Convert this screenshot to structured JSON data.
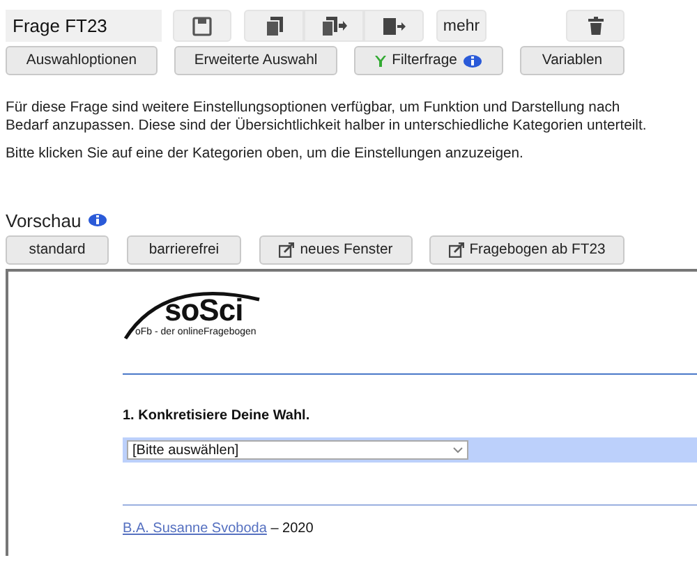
{
  "toolbar": {
    "question_field": {
      "value": "Frage FT23"
    },
    "save_button": {
      "kind": "save"
    },
    "copy_tools": [
      {
        "kind": "copy"
      },
      {
        "kind": "copy-move"
      },
      {
        "kind": "move"
      }
    ],
    "more_button": {
      "label": "mehr"
    },
    "delete_button": {
      "kind": "delete"
    }
  },
  "categories": [
    {
      "label": "Auswahloptionen",
      "kind": "plain"
    },
    {
      "label": "Erweiterte Auswahl",
      "kind": "plain"
    },
    {
      "label": "Filterfrage",
      "kind": "filter"
    },
    {
      "label": "Variablen",
      "kind": "plain"
    }
  ],
  "intro": [
    "Für diese Frage sind weitere Einstellungsoptionen verfügbar, um Funktion und Darstellung nach Bedarf anzupassen. Diese sind der Übersichtlichkeit halber in unterschiedliche Kategorien unterteilt.",
    "Bitte klicken Sie auf eine der Kategorien oben, um die Einstellungen anzuzeigen."
  ],
  "preview": {
    "title": "Vorschau",
    "buttons": [
      {
        "label": "standard",
        "kind": "plain"
      },
      {
        "label": "barrierefrei",
        "kind": "plain"
      },
      {
        "label": "neues Fenster",
        "kind": "external"
      },
      {
        "label": "Fragebogen ab FT23",
        "kind": "external"
      }
    ],
    "logo": {
      "title": "soSci",
      "subtitle": "oFb - der onlineFragebogen"
    },
    "question": "1. Konkretisiere Deine Wahl.",
    "select": {
      "value": "[Bitte auswählen]"
    },
    "footer": {
      "author": "B.A. Susanne Svoboda",
      "rest": "– 2020"
    }
  }
}
